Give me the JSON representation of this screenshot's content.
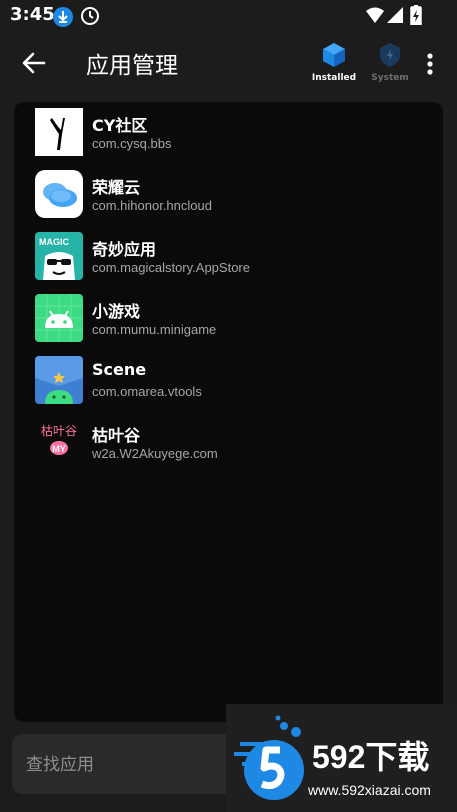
{
  "status_bar": {
    "time": "3:45"
  },
  "toolbar": {
    "title": "应用管理",
    "tabs": [
      {
        "label": "Installed",
        "active": true
      },
      {
        "label": "System",
        "active": false
      }
    ]
  },
  "apps": [
    {
      "name": "CY社区",
      "package": "com.cysq.bbs"
    },
    {
      "name": "荣耀云",
      "package": "com.hihonor.hncloud"
    },
    {
      "name": "奇妙应用",
      "package": "com.magicalstory.AppStore",
      "icon_text": "MAGIC"
    },
    {
      "name": "小游戏",
      "package": "com.mumu.minigame"
    },
    {
      "name": "Scene",
      "package": "com.omarea.vtools"
    },
    {
      "name": "枯叶谷",
      "package": "w2a.W2Akuyege.com",
      "icon_text": "枯叶谷",
      "icon_badge": "MY"
    }
  ],
  "search": {
    "placeholder": "查找应用"
  },
  "watermark": {
    "brand": "592下载",
    "url": "www.592xiazai.com"
  },
  "colors": {
    "accent": "#1e88e5",
    "panel": "#0a0a0a",
    "background": "#1c1c1c"
  }
}
